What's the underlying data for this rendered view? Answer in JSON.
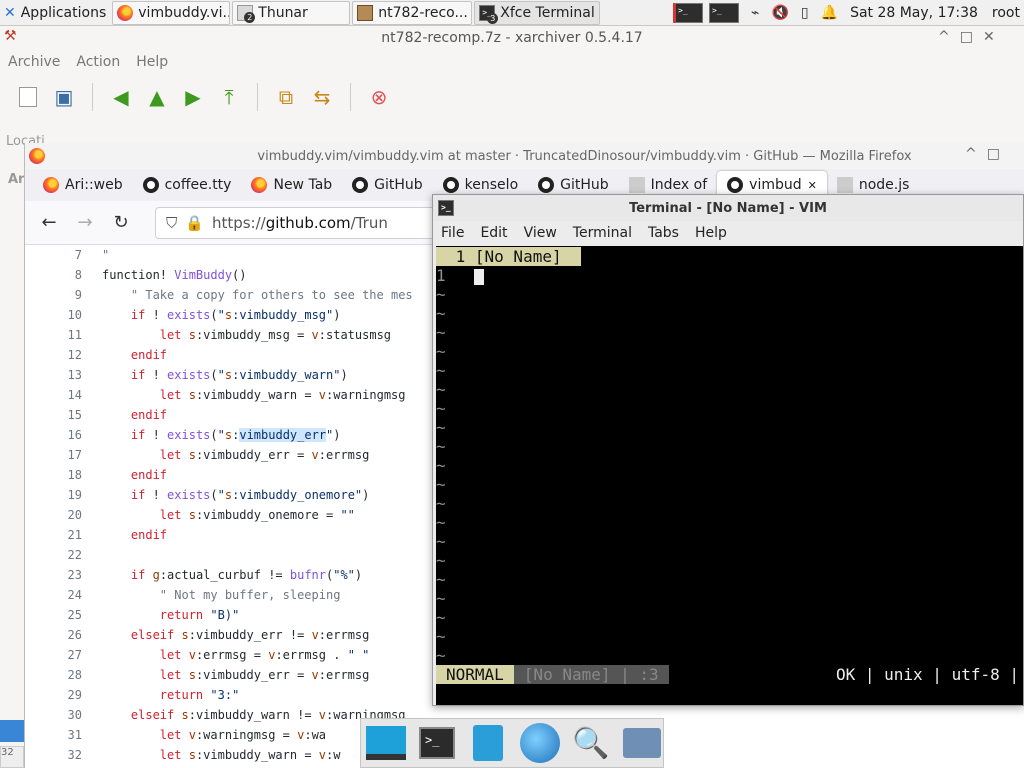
{
  "panel": {
    "apps_label": "Applications",
    "tasks": [
      {
        "label": "vimbuddy.vi...",
        "icon": "firefox-icon",
        "count": ""
      },
      {
        "label": "Thunar",
        "icon": "folder-icon",
        "count": "2"
      },
      {
        "label": "nt782-reco...",
        "icon": "archive-icon",
        "count": ""
      },
      {
        "label": "Xfce Terminal",
        "icon": "terminal-icon",
        "count": "3"
      }
    ],
    "clock": "Sat 28 May, 17:38",
    "user": "root"
  },
  "xarchiver": {
    "title": "nt782-recomp.7z - xarchiver 0.5.4.17",
    "menu": [
      "Archive",
      "Action",
      "Help"
    ],
    "location_label": "Locati",
    "sidebar_text": "Ar",
    "status_fragment": "32"
  },
  "firefox": {
    "title": "vimbuddy.vim/vimbuddy.vim at master · TruncatedDinosour/vimbuddy.vim · GitHub — Mozilla Firefox",
    "tabs": [
      {
        "label": "Ari::web",
        "icon": "firefox-icon"
      },
      {
        "label": "coffee.tty",
        "icon": "github-icon"
      },
      {
        "label": "New Tab",
        "icon": "firefox-icon"
      },
      {
        "label": "GitHub",
        "icon": "github-icon"
      },
      {
        "label": "kenselo",
        "icon": "github-icon"
      },
      {
        "label": "GitHub",
        "icon": "github-icon"
      },
      {
        "label": "Index of",
        "icon": "page-icon"
      },
      {
        "label": "vimbud",
        "icon": "github-icon",
        "active": true
      },
      {
        "label": "node.js",
        "icon": "page-icon"
      }
    ],
    "url_prefix": "https://",
    "url_host": "github.com",
    "url_rest": "/Trun"
  },
  "code": [
    {
      "n": "7",
      "t": "\""
    },
    {
      "n": "8",
      "t": "function! VimBuddy()"
    },
    {
      "n": "9",
      "t": "    \" Take a copy for others to see the mes"
    },
    {
      "n": "10",
      "t": "    if ! exists(\"s:vimbuddy_msg\")"
    },
    {
      "n": "11",
      "t": "        let s:vimbuddy_msg = v:statusmsg"
    },
    {
      "n": "12",
      "t": "    endif"
    },
    {
      "n": "13",
      "t": "    if ! exists(\"s:vimbuddy_warn\")"
    },
    {
      "n": "14",
      "t": "        let s:vimbuddy_warn = v:warningmsg"
    },
    {
      "n": "15",
      "t": "    endif"
    },
    {
      "n": "16",
      "t": "    if ! exists(\"s:vimbuddy_err\")"
    },
    {
      "n": "17",
      "t": "        let s:vimbuddy_err = v:errmsg"
    },
    {
      "n": "18",
      "t": "    endif"
    },
    {
      "n": "19",
      "t": "    if ! exists(\"s:vimbuddy_onemore\")"
    },
    {
      "n": "20",
      "t": "        let s:vimbuddy_onemore = \"\""
    },
    {
      "n": "21",
      "t": "    endif"
    },
    {
      "n": "22",
      "t": ""
    },
    {
      "n": "23",
      "t": "    if g:actual_curbuf != bufnr(\"%\")"
    },
    {
      "n": "24",
      "t": "        \" Not my buffer, sleeping"
    },
    {
      "n": "25",
      "t": "        return \"B)\""
    },
    {
      "n": "26",
      "t": "    elseif s:vimbuddy_err != v:errmsg"
    },
    {
      "n": "27",
      "t": "        let v:errmsg = v:errmsg . \" \""
    },
    {
      "n": "28",
      "t": "        let s:vimbuddy_err = v:errmsg"
    },
    {
      "n": "29",
      "t": "        return \"3:\""
    },
    {
      "n": "30",
      "t": "    elseif s:vimbuddy_warn != v:warningmsg"
    },
    {
      "n": "31",
      "t": "        let v:warningmsg = v:wa"
    },
    {
      "n": "32",
      "t": "        let s:vimbuddy_warn = v:w"
    }
  ],
  "terminal": {
    "title": "Terminal - [No Name] - VIM",
    "menu": [
      "File",
      "Edit",
      "View",
      "Terminal",
      "Tabs",
      "Help"
    ],
    "vim": {
      "tab_label": " 1 [No Name] ",
      "line_number": "1",
      "tilde": "~",
      "mode": "NORMAL",
      "buffer": "[No Name]",
      "buffer_extra": "| :3",
      "right": "OK | unix | utf-8 |"
    }
  },
  "dock": [
    "desktop-icon",
    "terminal-icon",
    "file-manager-icon",
    "web-browser-icon",
    "search-icon",
    "folder-icon"
  ]
}
